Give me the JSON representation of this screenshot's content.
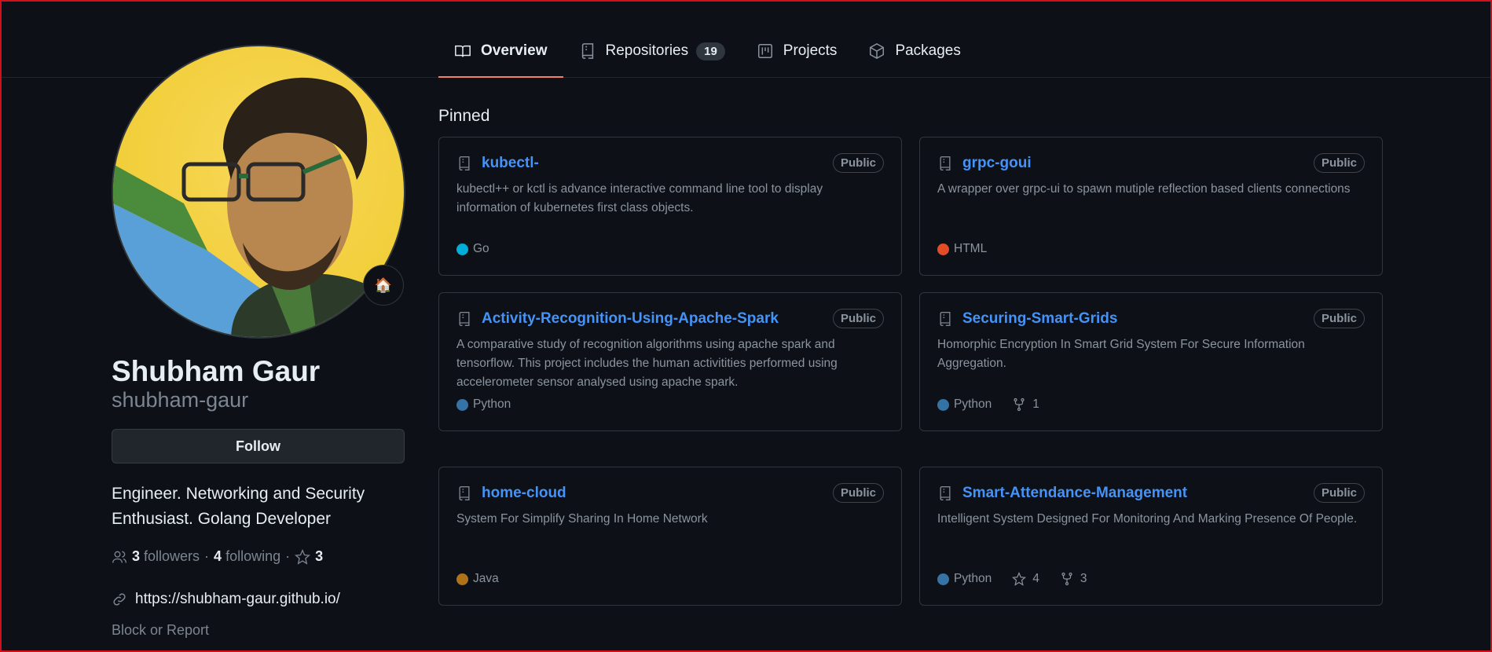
{
  "tabs": [
    {
      "label": "Overview",
      "icon": "book-icon"
    },
    {
      "label": "Repositories",
      "icon": "repo-icon",
      "count": "19"
    },
    {
      "label": "Projects",
      "icon": "project-icon"
    },
    {
      "label": "Packages",
      "icon": "package-icon"
    }
  ],
  "profile": {
    "name": "Shubham Gaur",
    "login": "shubham-gaur",
    "follow_label": "Follow",
    "bio": "Engineer. Networking and Security Enthusiast. Golang Developer",
    "followers_count": "3",
    "followers_label": "followers",
    "following_count": "4",
    "following_label": "following",
    "stars_count": "3",
    "separator": "·",
    "website": "https://shubham-gaur.github.io/",
    "report_label": "Block or Report",
    "status_emoji": "🏠"
  },
  "pinned": {
    "title": "Pinned",
    "cards": [
      {
        "name": "kubectl-",
        "visibility": "Public",
        "description": "kubectl++ or kctl is advance interactive command line tool to display information of kubernetes first class objects.",
        "language": "Go",
        "lang_color": "#00add8"
      },
      {
        "name": "grpc-goui",
        "visibility": "Public",
        "description": "A wrapper over grpc-ui to spawn mutiple reflection based clients connections",
        "language": "HTML",
        "lang_color": "#e34c26"
      },
      {
        "name": "Activity-Recognition-Using-Apache-Spark",
        "visibility": "Public",
        "description": "A comparative study of recognition algorithms using apache spark and tensorflow. This project includes the human activitities performed using accelerometer sensor analysed using apache spark.",
        "language": "Python",
        "lang_color": "#3572a5"
      },
      {
        "name": "Securing-Smart-Grids",
        "visibility": "Public",
        "description": "Homorphic Encryption In Smart Grid System For Secure Information Aggregation.",
        "language": "Python",
        "lang_color": "#3572a5",
        "forks": "1"
      },
      {
        "name": "home-cloud",
        "visibility": "Public",
        "description": "System For Simplify Sharing In Home Network",
        "language": "Java",
        "lang_color": "#b07219"
      },
      {
        "name": "Smart-Attendance-Management",
        "visibility": "Public",
        "description": "Intelligent System Designed For Monitoring And Marking Presence Of People.",
        "language": "Python",
        "lang_color": "#3572a5",
        "stars": "4",
        "forks": "3"
      }
    ]
  }
}
